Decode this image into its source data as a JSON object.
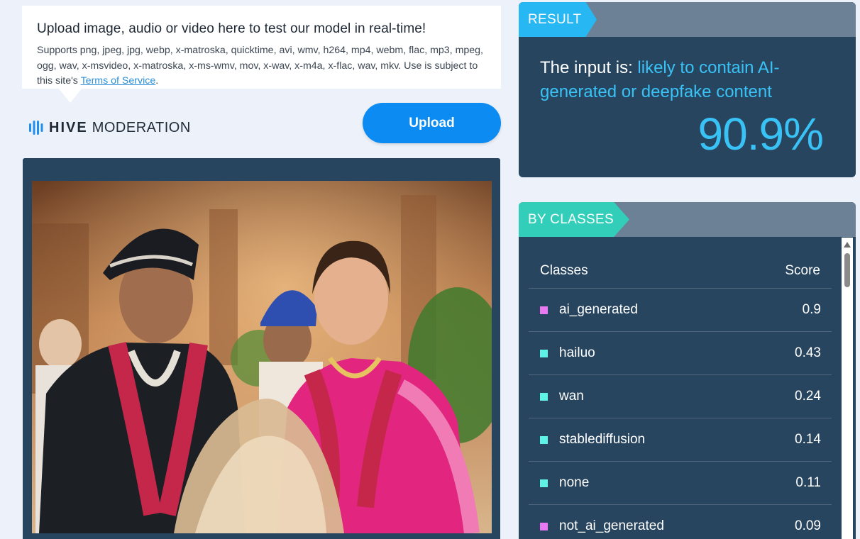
{
  "info": {
    "title": "Upload image, audio or video here to test our model in real-time!",
    "supports": "Supports png, jpeg, jpg, webp, x-matroska, quicktime, avi, wmv, h264, mp4, webm, flac, mp3, mpeg, ogg, wav, x-msvideo, x-matroska, x-ms-wmv, mov, x-wav, x-m4a, x-flac, wav, mkv. Use is subject to this site's ",
    "terms_link": "Terms of Service",
    "terms_suffix": "."
  },
  "brand": {
    "name_bold": "HIVE",
    "name_light": "MODERATION"
  },
  "upload_button": "Upload",
  "result": {
    "tag": "RESULT",
    "prefix": "The input is: ",
    "verdict": "likely to contain AI-generated or deepfake content",
    "score": "90.9%"
  },
  "classes": {
    "tag": "BY CLASSES",
    "header_classes": "Classes",
    "header_score": "Score",
    "rows": [
      {
        "name": "ai_generated",
        "score": "0.9",
        "color": "#e879f0"
      },
      {
        "name": "hailuo",
        "score": "0.43",
        "color": "#5ff2e6"
      },
      {
        "name": "wan",
        "score": "0.24",
        "color": "#5ff2e6"
      },
      {
        "name": "stablediffusion",
        "score": "0.14",
        "color": "#5ff2e6"
      },
      {
        "name": "none",
        "score": "0.11",
        "color": "#5ff2e6"
      },
      {
        "name": "not_ai_generated",
        "score": "0.09",
        "color": "#e879f0"
      }
    ]
  },
  "colors": {
    "accent_blue": "#39c2f5",
    "upload_blue": "#0c8cf2",
    "panel_navy": "#284560",
    "header_slate": "#6c8196",
    "classes_teal": "#32ceba"
  },
  "icons": {
    "brand": "hive-bars-icon",
    "scroll": "scroll-up-arrow-icon"
  }
}
